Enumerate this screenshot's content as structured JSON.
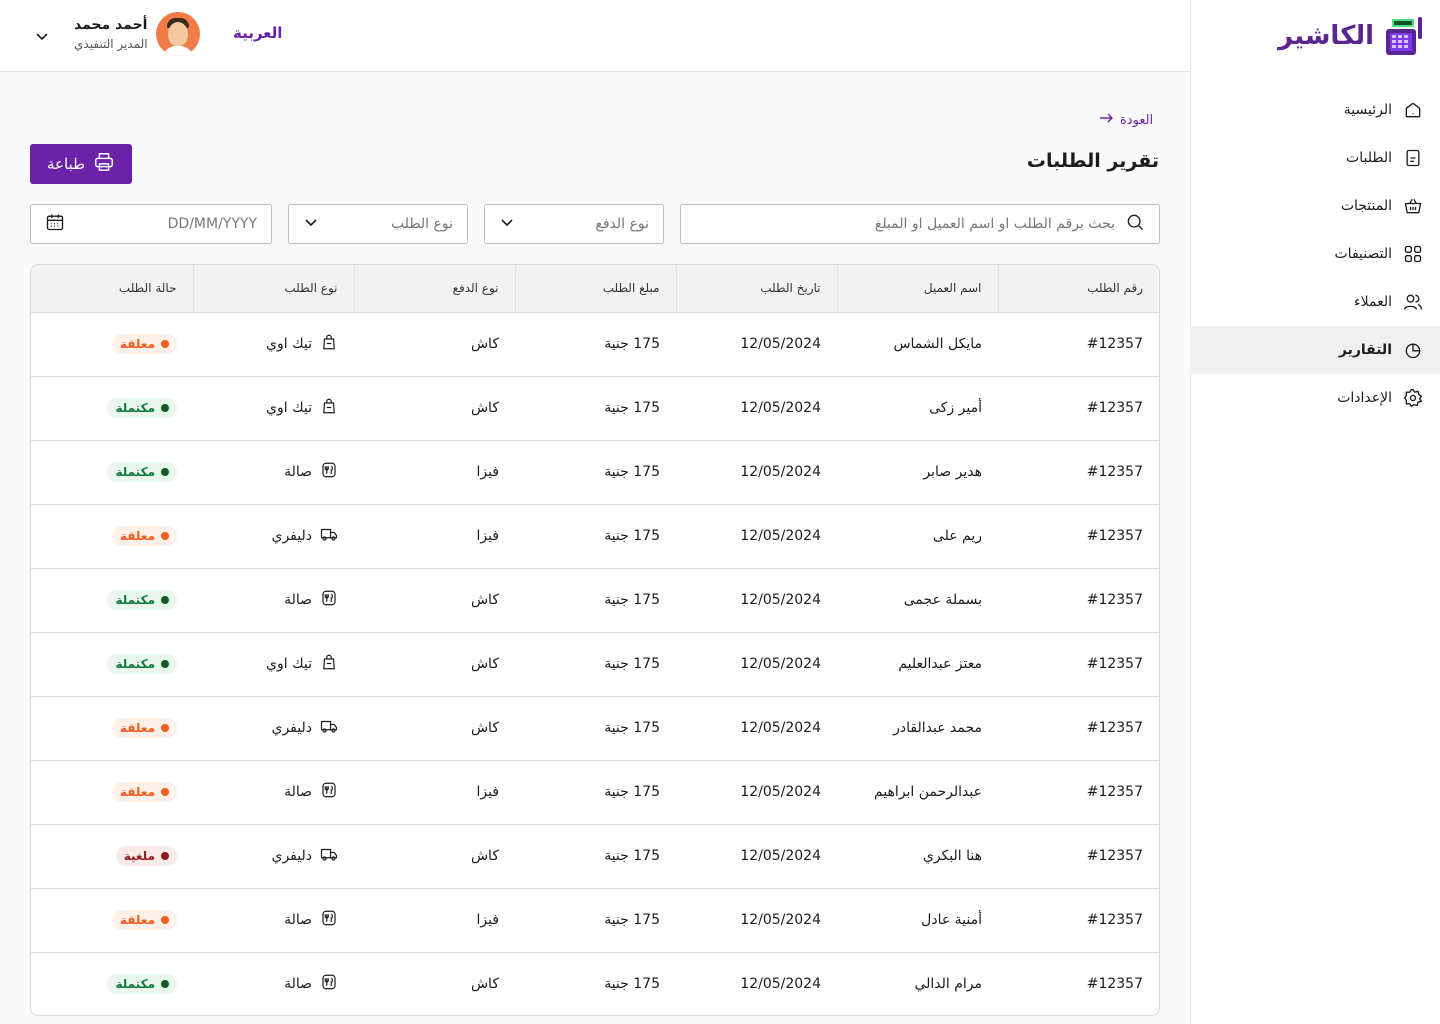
{
  "app": {
    "logo_text": "الكاشير",
    "brand_color": "#6b21a8"
  },
  "sidebar": {
    "items": [
      {
        "label": "الرئيسية",
        "icon": "home-icon",
        "active": false
      },
      {
        "label": "الطلبات",
        "icon": "orders-icon",
        "active": false
      },
      {
        "label": "المنتجات",
        "icon": "basket-icon",
        "active": false
      },
      {
        "label": "التصنيفات",
        "icon": "categories-icon",
        "active": false
      },
      {
        "label": "العملاء",
        "icon": "users-icon",
        "active": false
      },
      {
        "label": "التقارير",
        "icon": "reports-icon",
        "active": true
      },
      {
        "label": "الإعدادات",
        "icon": "settings-icon",
        "active": false
      }
    ]
  },
  "header": {
    "language": "العربية",
    "user_name": "أحمد محمد",
    "user_role": "المدير التنفيذي"
  },
  "page": {
    "back_label": "العودة",
    "title": "تقرير الطلبات",
    "print_label": "طباعة"
  },
  "filters": {
    "search_placeholder": "بحث برقم الطلب او اسم العميل او المبلغ",
    "payment_type_placeholder": "نوع الدفع",
    "order_type_placeholder": "نوع الطلب",
    "date_placeholder": "DD/MM/YYYY"
  },
  "table": {
    "headers": [
      "رقم الطلب",
      "اسم العميل",
      "تاريخ الطلب",
      "مبلغ الطلب",
      "نوع الدفع",
      "نوع الطلب",
      "حالة الطلب"
    ],
    "rows": [
      {
        "id": "#12357",
        "customer": "مايكل الشماس",
        "date": "12/05/2024",
        "amount": "175 جنية",
        "payment": "كاش",
        "type": "تيك اوي",
        "type_icon": "takeaway-bag-icon",
        "status": "معلقة",
        "status_kind": "pending"
      },
      {
        "id": "#12357",
        "customer": "أمير زكى",
        "date": "12/05/2024",
        "amount": "175 جنية",
        "payment": "كاش",
        "type": "تيك اوي",
        "type_icon": "takeaway-bag-icon",
        "status": "مكتملة",
        "status_kind": "done"
      },
      {
        "id": "#12357",
        "customer": "هدير صابر",
        "date": "12/05/2024",
        "amount": "175 جنية",
        "payment": "فيزا",
        "type": "صالة",
        "type_icon": "dine-in-icon",
        "status": "مكتملة",
        "status_kind": "done"
      },
      {
        "id": "#12357",
        "customer": "ريم على",
        "date": "12/05/2024",
        "amount": "175 جنية",
        "payment": "فيزا",
        "type": "دليفري",
        "type_icon": "delivery-truck-icon",
        "status": "معلقة",
        "status_kind": "pending"
      },
      {
        "id": "#12357",
        "customer": "بسملة عجمى",
        "date": "12/05/2024",
        "amount": "175 جنية",
        "payment": "كاش",
        "type": "صالة",
        "type_icon": "dine-in-icon",
        "status": "مكتملة",
        "status_kind": "done"
      },
      {
        "id": "#12357",
        "customer": "معتز عبدالعليم",
        "date": "12/05/2024",
        "amount": "175 جنية",
        "payment": "كاش",
        "type": "تيك اوي",
        "type_icon": "takeaway-bag-icon",
        "status": "مكتملة",
        "status_kind": "done"
      },
      {
        "id": "#12357",
        "customer": "محمد عبدالقادر",
        "date": "12/05/2024",
        "amount": "175 جنية",
        "payment": "كاش",
        "type": "دليفري",
        "type_icon": "delivery-truck-icon",
        "status": "معلقة",
        "status_kind": "pending"
      },
      {
        "id": "#12357",
        "customer": "عبدالرحمن ابراهيم",
        "date": "12/05/2024",
        "amount": "175 جنية",
        "payment": "فيزا",
        "type": "صالة",
        "type_icon": "dine-in-icon",
        "status": "معلقة",
        "status_kind": "pending"
      },
      {
        "id": "#12357",
        "customer": "هنا البكري",
        "date": "12/05/2024",
        "amount": "175 جنية",
        "payment": "كاش",
        "type": "دليفري",
        "type_icon": "delivery-truck-icon",
        "status": "ملغية",
        "status_kind": "cancel"
      },
      {
        "id": "#12357",
        "customer": "أمنية عادل",
        "date": "12/05/2024",
        "amount": "175 جنية",
        "payment": "فيزا",
        "type": "صالة",
        "type_icon": "dine-in-icon",
        "status": "معلقة",
        "status_kind": "pending"
      },
      {
        "id": "#12357",
        "customer": "مرام الدالي",
        "date": "12/05/2024",
        "amount": "175 جنية",
        "payment": "كاش",
        "type": "صالة",
        "type_icon": "dine-in-icon",
        "status": "مكتملة",
        "status_kind": "done"
      }
    ]
  },
  "status_colors": {
    "pending": "#f25a1c",
    "done": "#0e7a37",
    "cancel": "#9b1c1c"
  }
}
